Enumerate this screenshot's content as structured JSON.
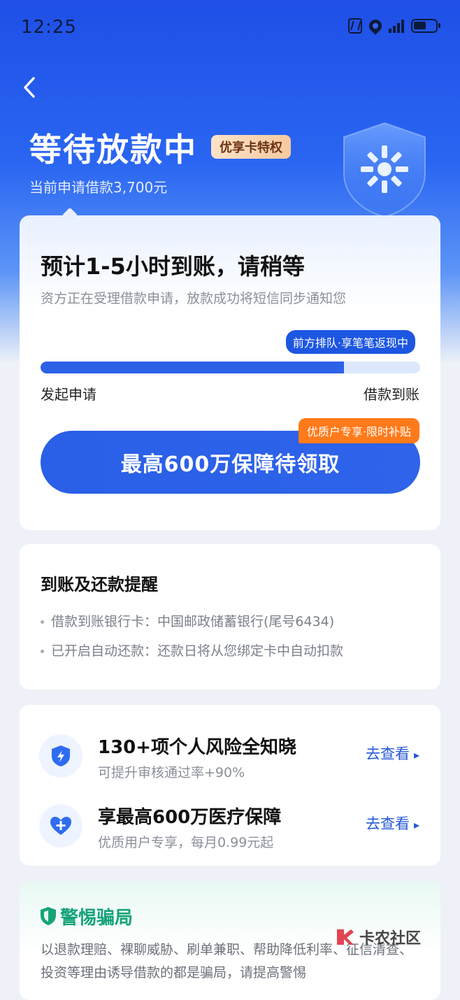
{
  "status_bar": {
    "time": "12:25"
  },
  "header": {
    "title": "等待放款中",
    "badge": "优享卡特权",
    "subtitle": "当前申请借款3,700元"
  },
  "progress_card": {
    "eta": "预计1-5小时到账，请稍等",
    "description": "资方正在受理借款申请，放款成功将短信同步通知您",
    "queue_tag": "前方排队·享笔笔返现中",
    "progress_fraction": 0.8,
    "step_start": "发起申请",
    "step_end": "借款到账",
    "cta_label": "最高600万保障待领取",
    "cta_tag": "优质户专享·限时补贴"
  },
  "reminder_card": {
    "title": "到账及还款提醒",
    "items": [
      "借款到账银行卡：中国邮政储蓄银行(尾号6434)",
      "已开启自动还款：还款日将从您绑定卡中自动扣款"
    ]
  },
  "features": [
    {
      "icon": "shield-bolt-icon",
      "title": "130+项个人风险全知晓",
      "subtitle": "可提升审核通过率+90%",
      "link": "去查看"
    },
    {
      "icon": "heart-plus-icon",
      "title": "享最高600万医疗保障",
      "subtitle": "优质用户专享，每月0.99元起",
      "link": "去查看"
    }
  ],
  "warning": {
    "title": "警惕骗局",
    "text": "以退款理赔、裸聊威胁、刷单兼职、帮助降低利率、征信清查、投资等理由诱导借款的都是骗局，请提高警惕"
  },
  "watermark": {
    "text": "卡农社区"
  },
  "colors": {
    "primary": "#2c62e6",
    "accent_orange": "#ff7a1a",
    "warning_green": "#16a37a"
  }
}
